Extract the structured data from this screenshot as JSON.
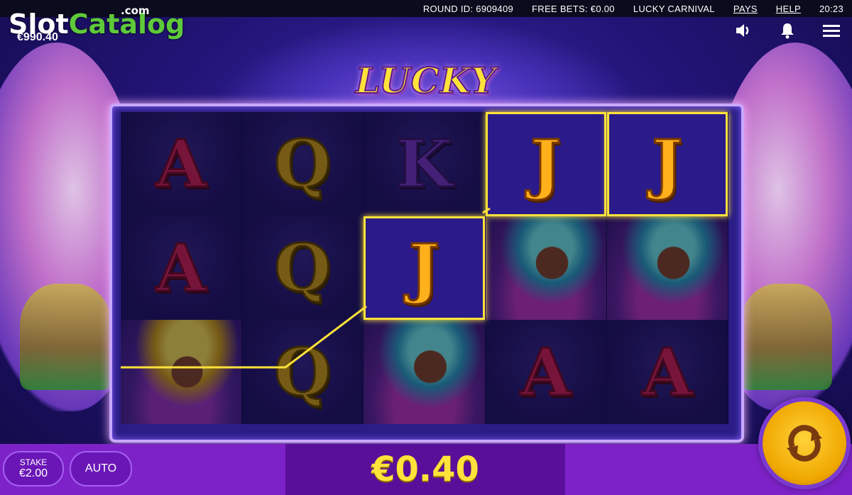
{
  "watermark": {
    "slot": "Slot",
    "catalog": "Catalog",
    "com": ".com"
  },
  "balance": "€990.40",
  "topbar": {
    "round_id": "ROUND ID: 6909409",
    "free_bets": "FREE BETS: €0.00",
    "game_name": "LUCKY CARNIVAL",
    "pays": "PAYS",
    "help": "HELP",
    "time": "20:23"
  },
  "icons": {
    "sound": "speaker-icon",
    "notifications": "bell-icon",
    "menu": "hamburger-menu-icon",
    "spin": "spin-arrows-icon"
  },
  "title": "LUCKY CARNIVAL",
  "reels": [
    [
      "A",
      "A",
      "dancer"
    ],
    [
      "Q",
      "Q",
      "Q"
    ],
    [
      "K",
      "J",
      "dancer"
    ],
    [
      "J",
      "dancer",
      "A"
    ],
    [
      "J",
      "dancer",
      "A"
    ]
  ],
  "winning_symbol": "J",
  "bottom": {
    "stake_label": "STAKE",
    "stake_value": "€2.00",
    "auto_label": "AUTO",
    "win_amount": "€0.40"
  },
  "colors": {
    "win_highlight": "#ffe23a",
    "bar": "#7d22c9",
    "panel": "#5a0f9a"
  }
}
